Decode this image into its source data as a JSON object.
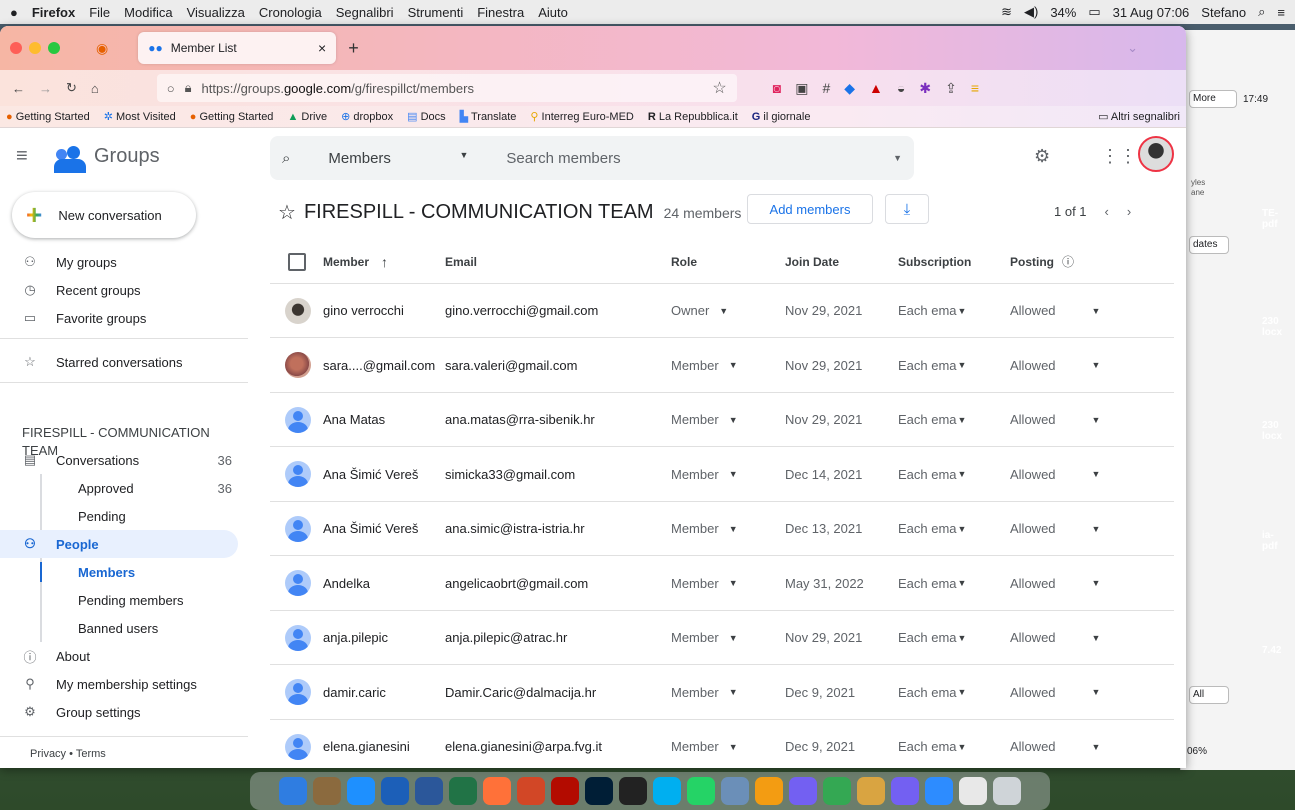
{
  "menubar": {
    "items": [
      "Firefox",
      "File",
      "Modifica",
      "Visualizza",
      "Cronologia",
      "Segnalibri",
      "Strumenti",
      "Finestra",
      "Aiuto"
    ],
    "battery": "34%",
    "datetime": "31 Aug 07:06",
    "user": "Stefano"
  },
  "bgwindow": {
    "more": "More",
    "time": "17:49",
    "dates": "dates",
    "all": "All",
    "pct": "06%",
    "styles": "yles",
    "pane": "ane"
  },
  "desktop_labels": [
    "TE-",
    "pdf",
    "230",
    "locx",
    "230",
    "locx",
    "ia-",
    "pdf",
    "7.42"
  ],
  "browser": {
    "tab_title": "Member List",
    "url_prefix": "https://groups.",
    "url_domain": "google.com",
    "url_path": "/g/firespillct/members",
    "bookmarks": [
      "Getting Started",
      "Most Visited",
      "Getting Started",
      "Drive",
      "dropbox",
      "Docs",
      "Translate",
      "Interreg Euro-MED",
      "La Repubblica.it",
      "il giornale"
    ],
    "other_bookmarks": "Altri segnalibri"
  },
  "app": {
    "name": "Groups",
    "search_scope": "Members",
    "search_placeholder": "Search members"
  },
  "sidebar": {
    "new_conversation": "New conversation",
    "my_groups": "My groups",
    "recent_groups": "Recent groups",
    "favorite_groups": "Favorite groups",
    "starred": "Starred conversations",
    "group_name": "FIRESPILL - COMMUNICATION TEAM",
    "conversations": "Conversations",
    "conversations_count": "36",
    "approved": "Approved",
    "approved_count": "36",
    "pending": "Pending",
    "people": "People",
    "members": "Members",
    "pending_members": "Pending members",
    "banned_users": "Banned users",
    "about": "About",
    "membership_settings": "My membership settings",
    "group_settings": "Group settings",
    "footer": "Privacy • Terms"
  },
  "main": {
    "title": "FIRESPILL - COMMUNICATION TEAM",
    "member_count": "24 members",
    "add_members": "Add members",
    "page": "1 of 1",
    "columns": {
      "member": "Member",
      "email": "Email",
      "role": "Role",
      "join": "Join Date",
      "subscription": "Subscription",
      "posting": "Posting"
    },
    "rows": [
      {
        "name": "gino verrocchi",
        "email": "gino.verrocchi@gmail.com",
        "role": "Owner",
        "join": "Nov 29, 2021",
        "sub": "Each ema",
        "posting": "Allowed",
        "avatar": "p1"
      },
      {
        "name": "sara....@gmail.com",
        "email": "sara.valeri@gmail.com",
        "role": "Member",
        "join": "Nov 29, 2021",
        "sub": "Each ema",
        "posting": "Allowed",
        "avatar": "p2"
      },
      {
        "name": "Ana Matas",
        "email": "ana.matas@rra-sibenik.hr",
        "role": "Member",
        "join": "Nov 29, 2021",
        "sub": "Each ema",
        "posting": "Allowed",
        "avatar": "gen"
      },
      {
        "name": "Ana Šimić Vereš",
        "email": "simicka33@gmail.com",
        "role": "Member",
        "join": "Dec 14, 2021",
        "sub": "Each ema",
        "posting": "Allowed",
        "avatar": "gen"
      },
      {
        "name": "Ana Šimić Vereš",
        "email": "ana.simic@istra-istria.hr",
        "role": "Member",
        "join": "Dec 13, 2021",
        "sub": "Each ema",
        "posting": "Allowed",
        "avatar": "gen"
      },
      {
        "name": "Andelka",
        "email": "angelicaobrt@gmail.com",
        "role": "Member",
        "join": "May 31, 2022",
        "sub": "Each ema",
        "posting": "Allowed",
        "avatar": "gen"
      },
      {
        "name": "anja.pilepic",
        "email": "anja.pilepic@atrac.hr",
        "role": "Member",
        "join": "Nov 29, 2021",
        "sub": "Each ema",
        "posting": "Allowed",
        "avatar": "gen"
      },
      {
        "name": "damir.caric",
        "email": "Damir.Caric@dalmacija.hr",
        "role": "Member",
        "join": "Dec 9, 2021",
        "sub": "Each ema",
        "posting": "Allowed",
        "avatar": "gen"
      },
      {
        "name": "elena.gianesini",
        "email": "elena.gianesini@arpa.fvg.it",
        "role": "Member",
        "join": "Dec 9, 2021",
        "sub": "Each ema",
        "posting": "Allowed",
        "avatar": "gen"
      }
    ]
  }
}
